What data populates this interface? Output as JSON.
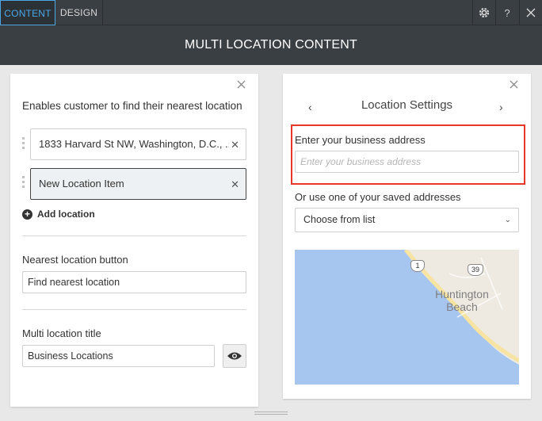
{
  "tabs": {
    "content": "CONTENT",
    "design": "DESIGN"
  },
  "header": {
    "title": "MULTI LOCATION CONTENT"
  },
  "left": {
    "description": "Enables customer to find their nearest location",
    "locations": [
      {
        "label": "1833 Harvard St NW, Washington, D.C., ...",
        "selected": false
      },
      {
        "label": "New Location Item",
        "selected": true
      }
    ],
    "add_label": "Add location",
    "nearest_button_label": "Nearest location button",
    "nearest_button_value": "Find nearest location",
    "title_label": "Multi location title",
    "title_value": "Business Locations"
  },
  "right": {
    "title": "Location Settings",
    "address_label": "Enter your business address",
    "address_placeholder": "Enter your business address",
    "saved_label": "Or use one of your saved addresses",
    "select_value": "Choose from list",
    "map": {
      "city": [
        "Huntington",
        "Beach"
      ],
      "route_1": "1",
      "route_39": "39"
    }
  },
  "colors": {
    "accent": "#4aa8e8",
    "highlight": "#e8382a",
    "header_bg": "#3a3f43"
  }
}
